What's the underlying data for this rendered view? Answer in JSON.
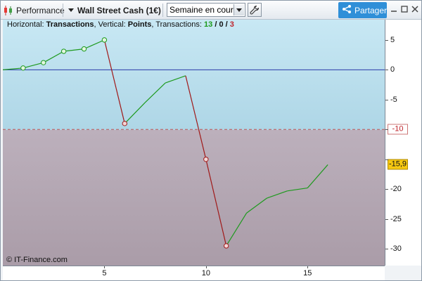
{
  "toolbar": {
    "performance_label": "Performance",
    "instrument_label": "Wall Street Cash (1€)",
    "period_select_value": "Semaine en cours",
    "share_label": "Partager",
    "share_icon": "share-icon",
    "settings_icon": "wrench-icon",
    "minimize_icon": "minimize-icon",
    "maximize_icon": "maximize-icon",
    "close_icon": "close-icon"
  },
  "info": {
    "prefix": "Horizontal: ",
    "horizontal_value": "Transactions",
    "middle": ", Vertical: ",
    "vertical_value": "Points",
    "transactions_prefix": ", Transactions: ",
    "wins": "13",
    "slash1": " / ",
    "neutral": "0",
    "slash2": " / ",
    "losses": "3"
  },
  "copyright": "© IT-Finance.com",
  "level_badge": "-10",
  "current_value_badge": "-15,9",
  "colors": {
    "up_line": "#1e9a1e",
    "down_line": "#a01818",
    "zero_line": "#2a3aa8",
    "threshold_line": "#c05050"
  },
  "chart_data": {
    "type": "line",
    "x": [
      0,
      1,
      2,
      3,
      4,
      5,
      6,
      7,
      8,
      9,
      10,
      11,
      12,
      13,
      14,
      15,
      16
    ],
    "y": [
      0,
      0.3,
      1.2,
      3.1,
      3.5,
      5,
      -9,
      -5.5,
      -2.2,
      -1,
      -15,
      -29.5,
      -24,
      -21.5,
      -20.3,
      -19.8,
      -15.9
    ],
    "segments_losing": [
      [
        5,
        6
      ],
      [
        9,
        10
      ],
      [
        10,
        11
      ]
    ],
    "markers": [
      {
        "x": 1,
        "y": 0.3,
        "kind": "win"
      },
      {
        "x": 2,
        "y": 1.2,
        "kind": "win"
      },
      {
        "x": 3,
        "y": 3.1,
        "kind": "win"
      },
      {
        "x": 4,
        "y": 3.5,
        "kind": "win"
      },
      {
        "x": 5,
        "y": 5,
        "kind": "win"
      },
      {
        "x": 6,
        "y": -9,
        "kind": "loss"
      },
      {
        "x": 10,
        "y": -15,
        "kind": "loss"
      },
      {
        "x": 11,
        "y": -29.5,
        "kind": "loss"
      }
    ],
    "xlim": [
      0,
      18.8
    ],
    "ylim": [
      -32.8,
      8.4
    ],
    "x_ticks": [
      5,
      10,
      15
    ],
    "y_ticks": [
      5,
      0,
      -5,
      -10,
      -15,
      -20,
      -25,
      -30
    ],
    "y_tick_labels": [
      "5",
      "0",
      "-5",
      "",
      "",
      "-20",
      "-25",
      "-30"
    ],
    "zero_line": 0,
    "threshold_line": -10
  }
}
